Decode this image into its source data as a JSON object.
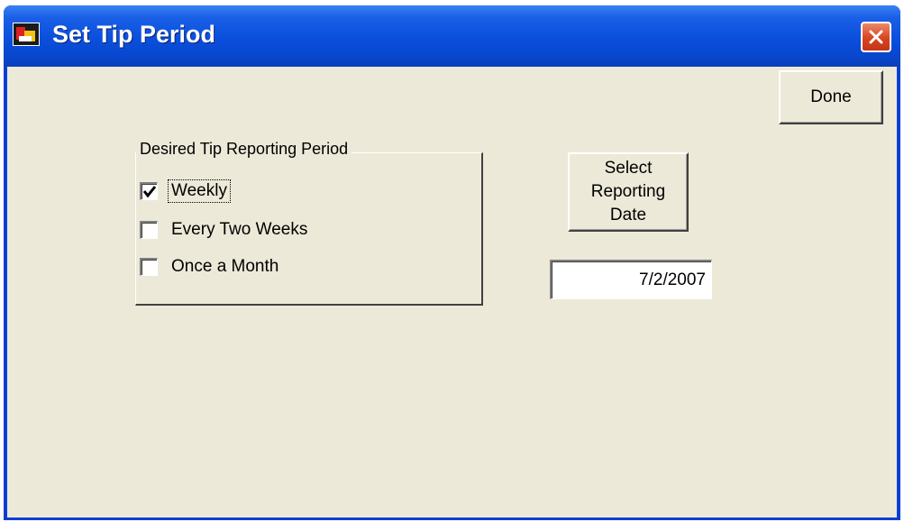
{
  "window": {
    "title": "Set Tip Period",
    "app_icon": "app-logo-icon",
    "close_icon": "close-icon"
  },
  "toolbar": {
    "done_label": "Done"
  },
  "period_group": {
    "label": "Desired Tip Reporting Period",
    "options": [
      {
        "label": "Weekly",
        "checked": true,
        "focused": true
      },
      {
        "label": "Every Two Weeks",
        "checked": false,
        "focused": false
      },
      {
        "label": "Once a Month",
        "checked": false,
        "focused": false
      }
    ]
  },
  "reporting_date": {
    "button_label": "Select Reporting Date",
    "button_lines": [
      "Select",
      "Reporting",
      "Date"
    ],
    "value": "7/2/2007"
  },
  "colors": {
    "title_bar": "#0a4fdc",
    "client_bg": "#ece9d8",
    "close_button": "#d8431f"
  }
}
